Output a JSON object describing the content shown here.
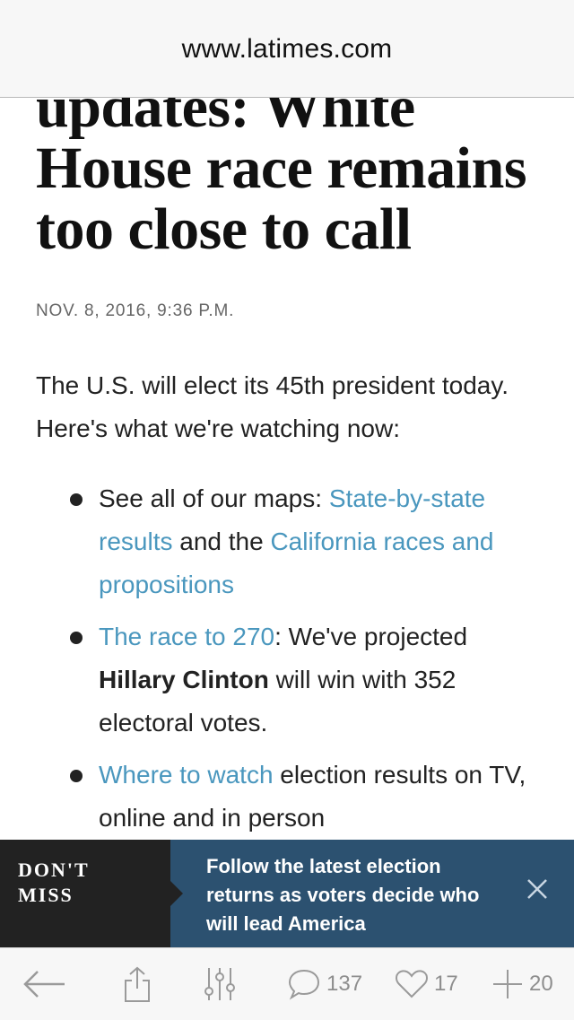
{
  "browser": {
    "url": "www.latimes.com"
  },
  "article": {
    "headline": "updates: White House race remains too close to call",
    "dateline": "NOV. 8, 2016, 9:36 P.M.",
    "intro": "The U.S. will elect its 45th president today. Here's what we're watching now:",
    "bullets": [
      {
        "prefix": "See all of our maps: ",
        "link1": "State-by-state results",
        "middle": " and the ",
        "link2": "California races and propositions"
      },
      {
        "link": "The race to 270",
        "after_link": ": We've projected ",
        "bold": "Hillary Clinton",
        "suffix": " will win with 352 electoral votes."
      },
      {
        "link": "Where to watch",
        "suffix": " election results on TV, online and in person"
      }
    ]
  },
  "banner": {
    "label": "DON'T MISS",
    "message": "Follow the latest election returns as voters decide who will lead America"
  },
  "toolbar": {
    "comments_count": "137",
    "likes_count": "17",
    "add_count": "20"
  },
  "colors": {
    "link": "#4a97be",
    "banner_bg": "#2c5170",
    "banner_label_bg": "#222222"
  }
}
